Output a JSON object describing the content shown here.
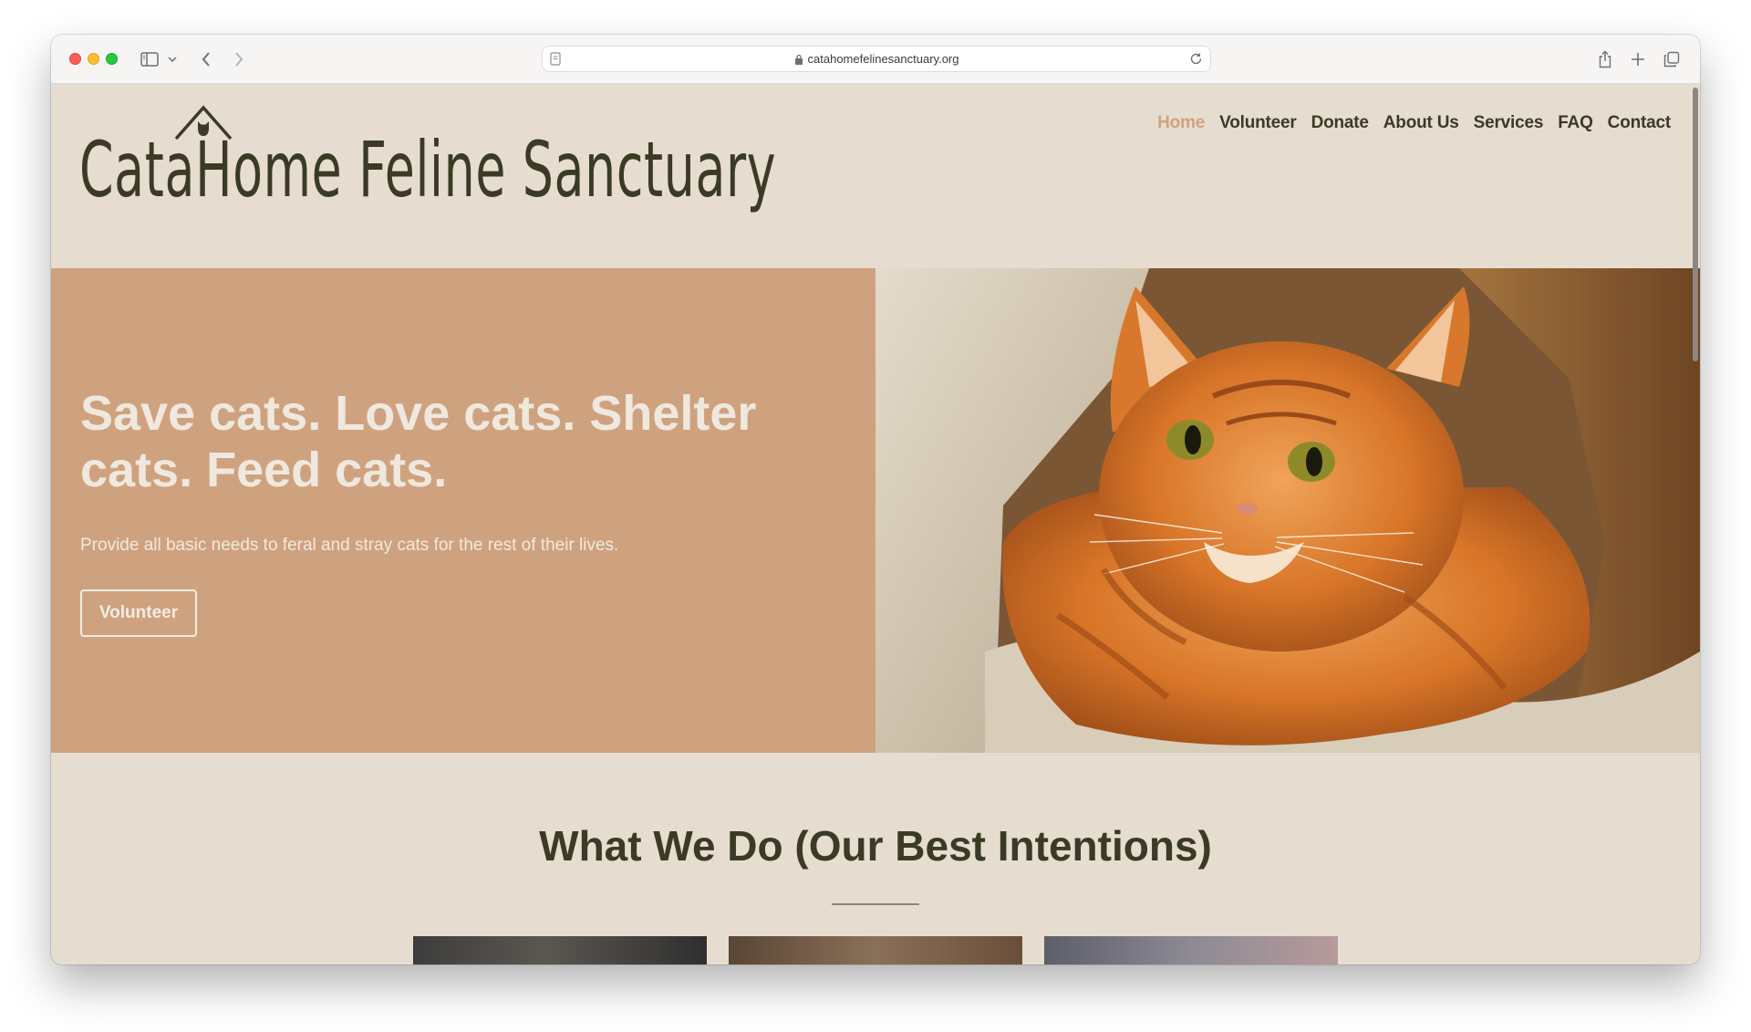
{
  "browser": {
    "url": "catahomefelinesanctuary.org"
  },
  "site": {
    "logo_text": "CataHome Feline Sanctuary",
    "nav": [
      {
        "label": "Home",
        "active": true
      },
      {
        "label": "Volunteer",
        "active": false
      },
      {
        "label": "Donate",
        "active": false
      },
      {
        "label": "About Us",
        "active": false
      },
      {
        "label": "Services",
        "active": false
      },
      {
        "label": "FAQ",
        "active": false
      },
      {
        "label": "Contact",
        "active": false
      }
    ]
  },
  "hero": {
    "title": "Save cats. Love cats. Shelter cats. Feed cats.",
    "subtitle": "Provide all basic needs to feral and stray cats for the rest of their lives.",
    "button_label": "Volunteer",
    "image": "orange-tabby-cat-photo"
  },
  "what_we_do": {
    "title": "What We Do (Our Best Intentions)",
    "thumbnails": [
      "cat-photo",
      "cat-photo",
      "cat-photo"
    ]
  },
  "colors": {
    "page_bg": "#e6ddd0",
    "hero_bg": "#cfa27f",
    "text_dark": "#3b3a25",
    "nav_active": "#cfa27f"
  }
}
